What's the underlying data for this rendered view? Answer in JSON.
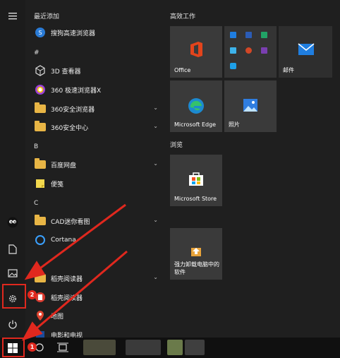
{
  "applist": {
    "recent_header": "最近添加",
    "recent_items": [
      {
        "label": "搜狗高速浏览器"
      }
    ],
    "sections": [
      {
        "letter": "#",
        "items": [
          {
            "label": "3D 查看器",
            "chevron": false
          },
          {
            "label": "360 极速浏览器X",
            "chevron": false
          },
          {
            "label": "360安全浏览器",
            "chevron": true
          },
          {
            "label": "360安全中心",
            "chevron": true
          }
        ]
      },
      {
        "letter": "B",
        "items": [
          {
            "label": "百度网盘",
            "chevron": true
          },
          {
            "label": "便笺",
            "chevron": false
          }
        ]
      },
      {
        "letter": "C",
        "items": [
          {
            "label": "CAD迷你看图",
            "chevron": true
          },
          {
            "label": "Cortana",
            "chevron": false
          }
        ]
      },
      {
        "letter": "",
        "items": [
          {
            "label": "稻壳阅读器",
            "chevron": true
          },
          {
            "label": "稻壳阅读器",
            "chevron": false
          },
          {
            "label": "地图",
            "chevron": false
          },
          {
            "label": "电影和电视",
            "chevron": false
          }
        ]
      }
    ]
  },
  "tiles": {
    "group1_title": "高效工作",
    "office": "Office",
    "mail": "邮件",
    "edge": "Microsoft Edge",
    "photos": "照片",
    "group2_title": "浏览",
    "store": "Microsoft Store",
    "uninstall": "强力卸载电脑中的软件"
  },
  "annotations": {
    "badge1": "1",
    "badge2": "2",
    "color": "#e0281e"
  }
}
